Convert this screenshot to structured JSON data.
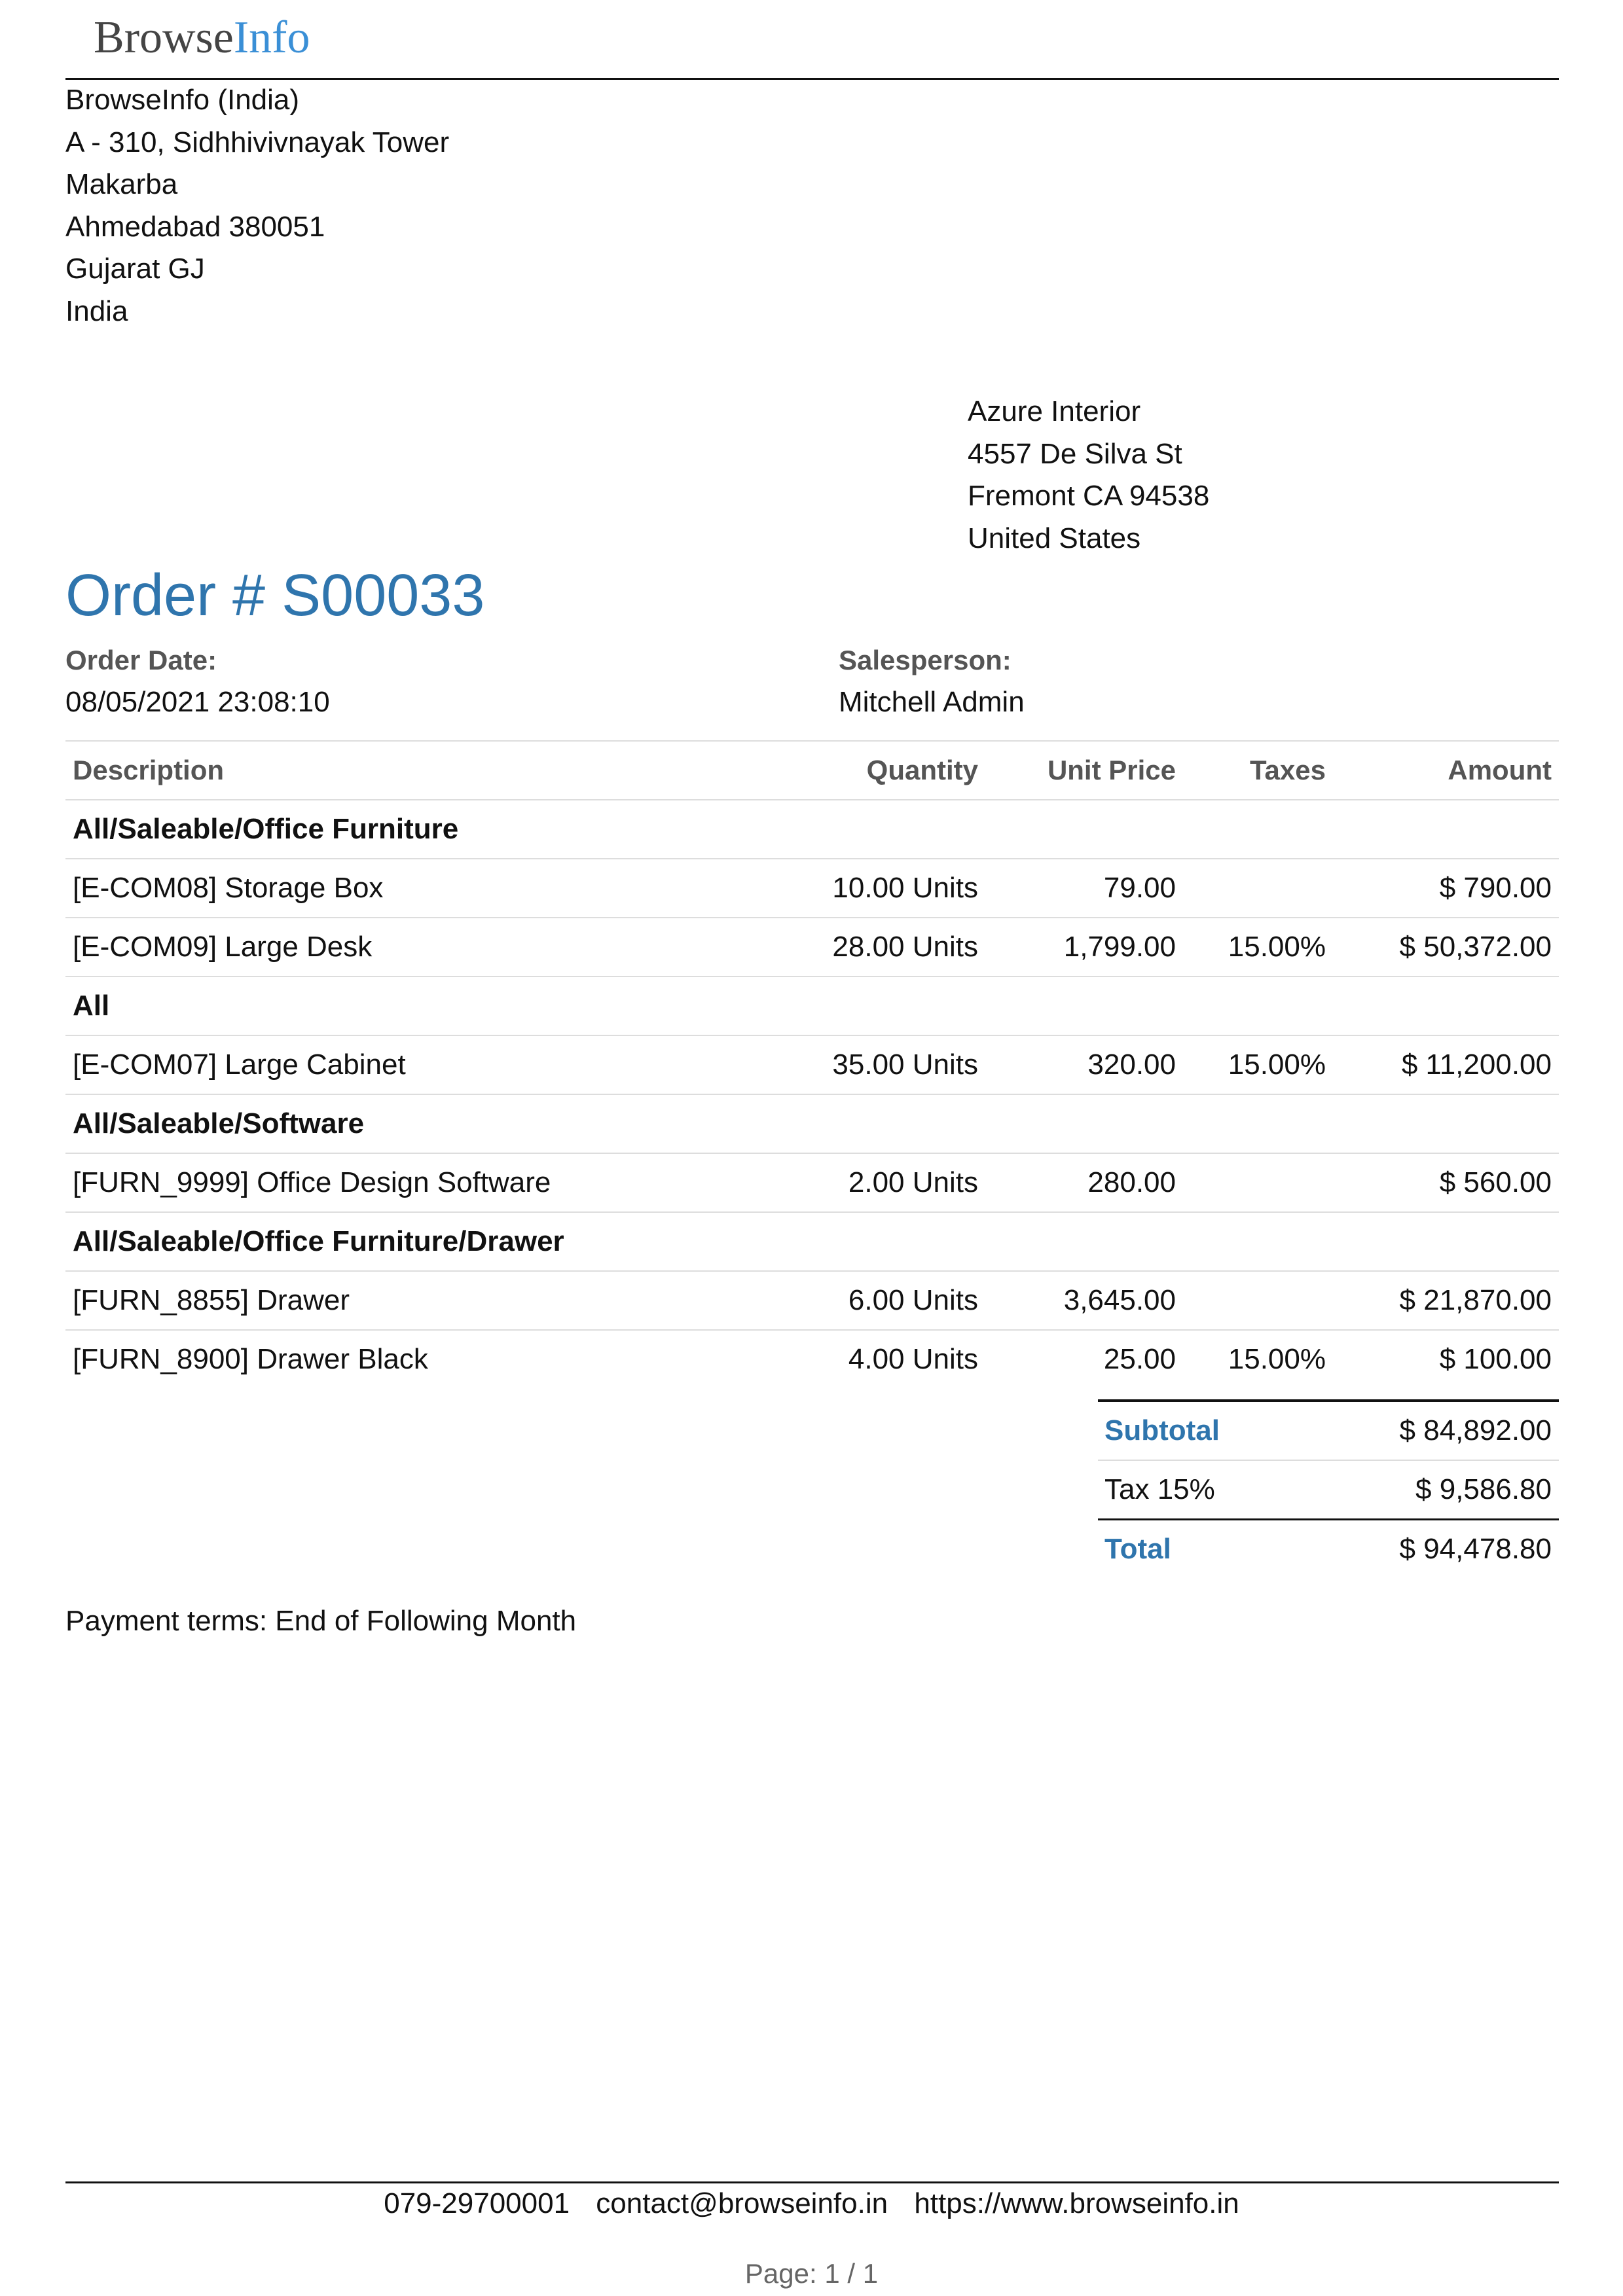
{
  "brand": {
    "part1": "Browse",
    "part2": "Info"
  },
  "company_address": [
    "BrowseInfo (India)",
    "A - 310, Sidhhivivnayak Tower",
    "Makarba",
    "Ahmedabad 380051",
    "Gujarat GJ",
    "India"
  ],
  "customer_address": [
    "Azure Interior",
    "4557 De Silva St",
    "Fremont CA 94538",
    "United States"
  ],
  "order": {
    "title": "Order # S00033",
    "date_label": "Order Date:",
    "date_value": "08/05/2021 23:08:10",
    "salesperson_label": "Salesperson:",
    "salesperson_value": "Mitchell Admin"
  },
  "table": {
    "headers": {
      "description": "Description",
      "quantity": "Quantity",
      "unit_price": "Unit Price",
      "taxes": "Taxes",
      "amount": "Amount"
    },
    "rows": [
      {
        "type": "section",
        "description": "All/Saleable/Office Furniture"
      },
      {
        "type": "line",
        "description": "[E-COM08] Storage Box",
        "quantity": "10.00 Units",
        "unit_price": "79.00",
        "taxes": "",
        "amount": "$ 790.00"
      },
      {
        "type": "line",
        "description": "[E-COM09] Large Desk",
        "quantity": "28.00 Units",
        "unit_price": "1,799.00",
        "taxes": "15.00%",
        "amount": "$ 50,372.00"
      },
      {
        "type": "section",
        "description": "All"
      },
      {
        "type": "line",
        "description": "[E-COM07] Large Cabinet",
        "quantity": "35.00 Units",
        "unit_price": "320.00",
        "taxes": "15.00%",
        "amount": "$ 11,200.00"
      },
      {
        "type": "section",
        "description": "All/Saleable/Software"
      },
      {
        "type": "line",
        "description": "[FURN_9999] Office Design Software",
        "quantity": "2.00 Units",
        "unit_price": "280.00",
        "taxes": "",
        "amount": "$ 560.00"
      },
      {
        "type": "section",
        "description": "All/Saleable/Office Furniture/Drawer"
      },
      {
        "type": "line",
        "description": "[FURN_8855] Drawer",
        "quantity": "6.00 Units",
        "unit_price": "3,645.00",
        "taxes": "",
        "amount": "$ 21,870.00"
      },
      {
        "type": "line",
        "description": "[FURN_8900] Drawer Black",
        "quantity": "4.00 Units",
        "unit_price": "25.00",
        "taxes": "15.00%",
        "amount": "$ 100.00"
      }
    ]
  },
  "totals": {
    "subtotal_label": "Subtotal",
    "subtotal_value": "$ 84,892.00",
    "tax_label": "Tax 15%",
    "tax_value": "$ 9,586.80",
    "total_label": "Total",
    "total_value": "$ 94,478.80"
  },
  "payment_terms": "Payment terms: End of Following Month",
  "footer": {
    "phone": "079-29700001",
    "email": "contact@browseinfo.in",
    "website": "https://www.browseinfo.in"
  },
  "page_label": "Page: 1 / 1",
  "colors": {
    "accent": "#2f75ad",
    "logo_blue": "#3a8fd6",
    "logo_gray": "#444444"
  }
}
